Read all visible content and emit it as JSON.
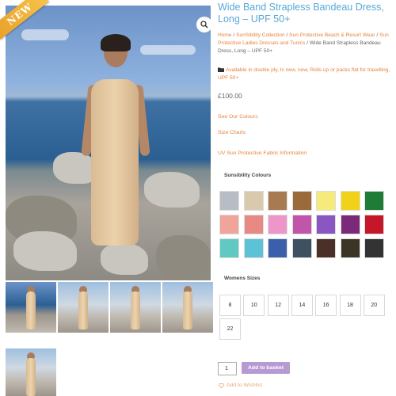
{
  "product": {
    "title": "Wide Band Strapless Bandeau Dress, Long – UPF 50+",
    "badge": "NEW",
    "price": "£100.00"
  },
  "breadcrumb": {
    "home": "Home",
    "sep": " / ",
    "cat1": "SunSibility Collection",
    "cat2": "Sun Protective Beach & Resort Wear",
    "cat3": "Sun Protective Ladies Dresses and Tunics",
    "current": "Wide Band Strapless Bandeau Dress, Long – UPF 50+"
  },
  "tags": "Available in double ply, Is new, new, Rolls up or packs flat for travelling, UPF 50+",
  "links": {
    "colours": "See Our Colours",
    "sizes": "Size Charts",
    "fabric": "UV Sun Protective Fabric Information"
  },
  "colours": {
    "label": "Sunsibility Colours",
    "swatches": [
      "#b8bcc4",
      "#d9c9ad",
      "#a87a52",
      "#9b6a3a",
      "#f6ea7a",
      "#f0d21a",
      "#1e7c36",
      "#f0a59a",
      "#e88a84",
      "#ef96c8",
      "#c055a9",
      "#8a56c2",
      "#7b2a7a",
      "#c5162a",
      "#62c9c2",
      "#5cc2d6",
      "#3b5faa",
      "#3f5160",
      "#4a3028",
      "#3b3526",
      "#333333"
    ]
  },
  "sizes": {
    "label": "Womens Sizes",
    "options": [
      "8",
      "10",
      "12",
      "14",
      "16",
      "18",
      "20",
      "22"
    ]
  },
  "cart": {
    "quantity": "1",
    "add_label": "Add to basket",
    "wishlist_label": "Add to Wishlist"
  },
  "icons": {
    "zoom": "magnifier-icon",
    "folder": "folder-icon",
    "heart": "heart-icon"
  }
}
